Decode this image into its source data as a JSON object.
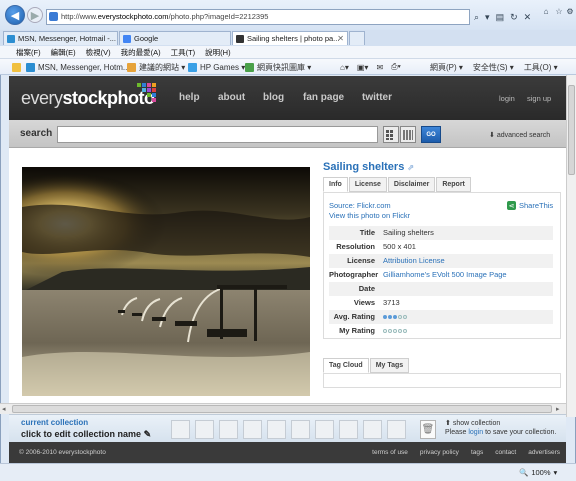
{
  "browser": {
    "url_prefix": "http://www.",
    "url_host": "everystockphoto.com",
    "url_path": "/photo.php?imageId=2212395",
    "tabs": [
      {
        "label": "MSN, Messenger, Hotmail -..."
      },
      {
        "label": "Google"
      },
      {
        "label": "Sailing shelters | photo pa..."
      }
    ],
    "menu": [
      "檔案(F)",
      "編輯(E)",
      "檢視(V)",
      "我的最愛(A)",
      "工具(T)",
      "說明(H)"
    ],
    "favorites": [
      "MSN, Messenger, Hotm...",
      "建議的網站 ▾",
      "HP Games ▾",
      "網頁快訊圖庫 ▾"
    ],
    "command_items": [
      "網頁(P) ▾",
      "安全性(S) ▾",
      "工具(O) ▾"
    ],
    "zoom": "100%",
    "colors": {
      "chrome": "#dfe9f5",
      "accent": "#2a71b8"
    }
  },
  "site": {
    "logo_plain": "every",
    "logo_bold": "stockphoto",
    "nav": [
      "help",
      "about",
      "blog",
      "fan page",
      "twitter"
    ],
    "account": [
      "login",
      "sign up"
    ],
    "search_label": "search",
    "search_placeholder": "",
    "go_label": "GO",
    "advanced_search": "advanced search"
  },
  "photo": {
    "title": "Sailing shelters",
    "tabs": [
      "Info",
      "License",
      "Disclaimer",
      "Report"
    ],
    "source_label": "Source: Flickr.com",
    "view_on_flickr": "View this photo on Flickr",
    "share_label": "ShareThis",
    "meta": [
      {
        "key": "Title",
        "value": "Sailing shelters"
      },
      {
        "key": "Resolution",
        "value": "500 x 401"
      },
      {
        "key": "License",
        "value": "Attribution License"
      },
      {
        "key": "Photographer",
        "value": "Gilliamhome's EVolt 500 Image Page"
      },
      {
        "key": "Date",
        "value": ""
      },
      {
        "key": "Views",
        "value": "3713"
      },
      {
        "key": "Avg. Rating",
        "value": ""
      },
      {
        "key": "My Rating",
        "value": ""
      }
    ],
    "avg_rating_fraction": 0.6,
    "tag_tabs": [
      "Tag Cloud",
      "My Tags"
    ]
  },
  "collection": {
    "current_label": "current collection",
    "click_label": "click to edit collection name",
    "show_label": "show collection",
    "login_prefix": "Please ",
    "login_link": "login",
    "login_suffix": " to save your collection."
  },
  "footer": {
    "copyright": "© 2006-2010 everystockphoto",
    "links": [
      "terms of use",
      "privacy policy",
      "tags",
      "contact",
      "advertisers"
    ]
  }
}
